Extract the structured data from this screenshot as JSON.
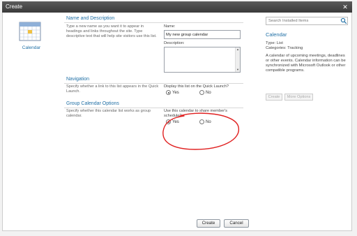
{
  "window": {
    "title": "Create",
    "close_glyph": "✕"
  },
  "left": {
    "item_label": "Calendar",
    "icon": "calendar-icon"
  },
  "sections": {
    "name": {
      "title": "Name and Description",
      "description": "Type a new name as you want it to appear in headings and links throughout the site. Type descriptive text that will help site visitors use this list.",
      "name_label": "Name:",
      "name_value": "My new group calendar",
      "description_label": "Description:"
    },
    "navigation": {
      "title": "Navigation",
      "description": "Specify whether a link to this list appears in the Quick Launch.",
      "question": "Display this list on the Quick Launch?",
      "options": [
        "Yes",
        "No"
      ],
      "selected": "Yes"
    },
    "group": {
      "title": "Group Calendar Options",
      "description": "Specify whether this calendar list works as group calendar.",
      "question": "Use this calendar to share member's schedule?",
      "options": [
        "Yes",
        "No"
      ],
      "selected": "Yes"
    }
  },
  "right": {
    "search_placeholder": "Search Installed Items",
    "title": "Calendar",
    "type_line": "Type: List",
    "categories_line": "Categories: Tracking",
    "description": "A calendar of upcoming meetings, deadlines or other events. Calendar information can be synchronized with Microsoft Outlook or other compatible programs.",
    "create_label": "Create",
    "more_options_label": "More Options"
  },
  "buttons": {
    "create_label": "Create",
    "cancel_label": "Cancel"
  },
  "colors": {
    "accent": "#1f6fa5",
    "titlebar": "#4a4a4a",
    "annotation": "#e02020"
  }
}
